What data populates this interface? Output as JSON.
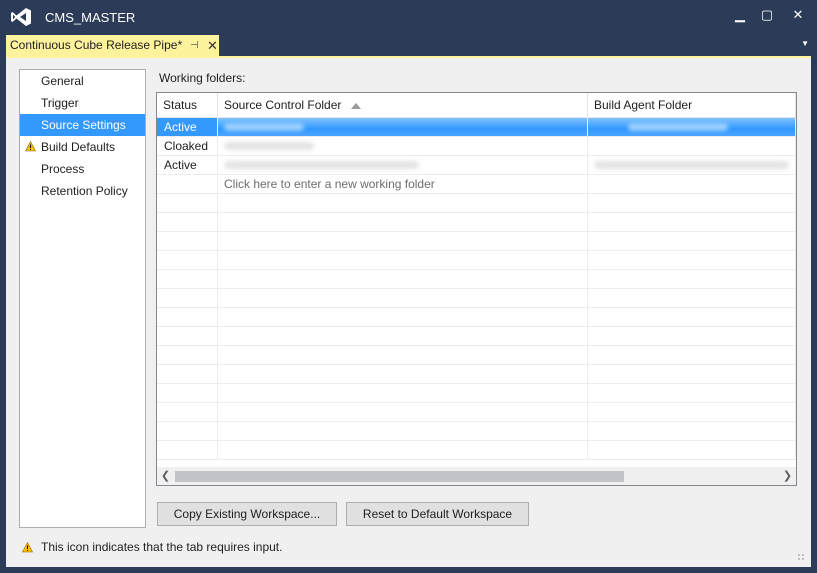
{
  "window": {
    "title": "CMS_MASTER",
    "minimize": "▁",
    "maximize": "▢",
    "close": "✕"
  },
  "tab": {
    "label": "Continuous Cube Release Pipe*",
    "pin": "⊣",
    "close": "✕",
    "menu_icon": "chevron-down-icon"
  },
  "nav": {
    "items": [
      {
        "label": "General",
        "selected": false,
        "warning": false
      },
      {
        "label": "Trigger",
        "selected": false,
        "warning": false
      },
      {
        "label": "Source Settings",
        "selected": true,
        "warning": false
      },
      {
        "label": "Build Defaults",
        "selected": false,
        "warning": true
      },
      {
        "label": "Process",
        "selected": false,
        "warning": false
      },
      {
        "label": "Retention Policy",
        "selected": false,
        "warning": false
      }
    ]
  },
  "working_folders": {
    "label": "Working folders:",
    "columns": [
      "Status",
      "Source Control Folder",
      "Build Agent Folder"
    ],
    "rows": [
      {
        "status": "Active",
        "selected": true
      },
      {
        "status": "Cloaked",
        "selected": false
      },
      {
        "status": "Active",
        "selected": false
      }
    ],
    "new_row_prompt": "Click here to enter a new working folder"
  },
  "buttons": {
    "copy_workspace": "Copy Existing Workspace...",
    "reset_workspace": "Reset to Default Workspace"
  },
  "footer": {
    "text": "This icon indicates that the tab requires input."
  },
  "colors": {
    "title_bar": "#2b3b58",
    "tab_accent": "#fff29d",
    "selection": "#3399ff",
    "warning": "#f2c200"
  }
}
